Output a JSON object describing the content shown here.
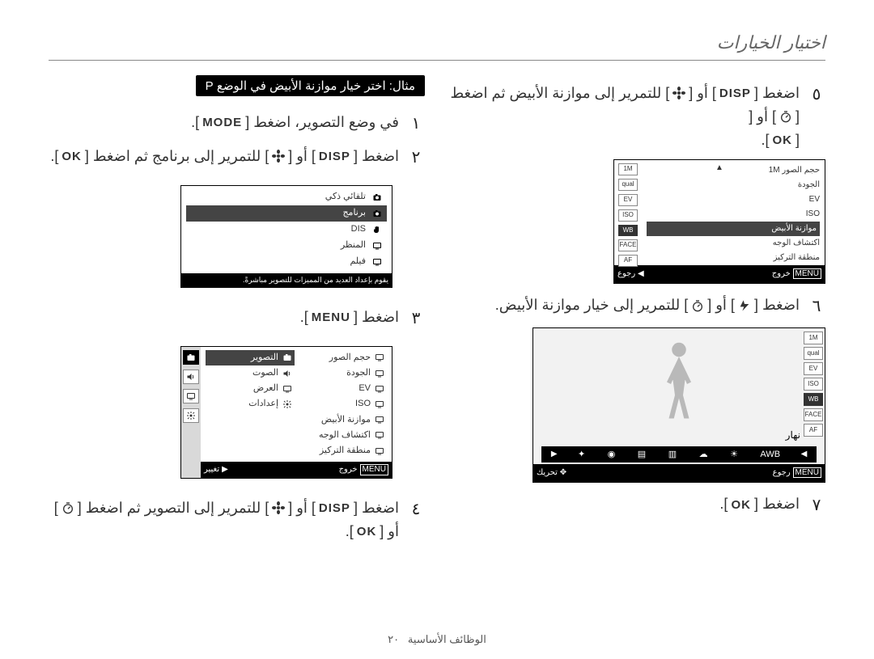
{
  "page": {
    "header": "اختيار الخيارات",
    "footer_label": "الوظائف الأساسية",
    "footer_page": "٢٠"
  },
  "example_badge": "مثال: اختر خيار موازنة الأبيض في الوضع P",
  "steps": {
    "n1": "١",
    "n2": "٢",
    "n3": "٣",
    "n4": "٤",
    "n5": "٥",
    "n6": "٦",
    "n7": "٧",
    "s1_a": "في وضع التصوير، اضغط [",
    "s1_b": "].",
    "s2_a": "اضغط [",
    "s2_b": "] أو [",
    "s2_c": "] للتمرير إلى برنامج ثم اضغط [",
    "s2_d": "].",
    "s3_a": "اضغط [",
    "s3_b": "].",
    "s4_a": "اضغط [",
    "s4_b": "] أو [",
    "s4_c": "] للتمرير إلى التصوير ثم اضغط [",
    "s4_d": "] أو [",
    "s4_e": "].",
    "s5_a": "اضغط [",
    "s5_b": "] أو [",
    "s5_c": "] للتمرير إلى موازنة الأبيض ثم اضغط [",
    "s5_d": "] أو [",
    "s5_e": "].",
    "s6_a": "اضغط [",
    "s6_b": "] أو [",
    "s6_c": "] للتمرير إلى خيار موازنة الأبيض.",
    "s7_a": "اضغط [",
    "s7_b": "]."
  },
  "keys": {
    "mode": "MODE",
    "disp": "DISP",
    "menu": "MENU",
    "ok": "OK",
    "macro": "flower-icon",
    "timer": "timer-icon",
    "flash": "flash-icon"
  },
  "screen_mode": {
    "items": [
      {
        "icon": "camera-auto-icon",
        "label": "تلقائي ذكي"
      },
      {
        "icon": "camera-icon",
        "label": "برنامج",
        "selected": true
      },
      {
        "icon": "hand-icon",
        "label": "DIS"
      },
      {
        "icon": "landscape-icon",
        "label": "المنظر"
      },
      {
        "icon": "film-icon",
        "label": "فيلم"
      }
    ],
    "note": "يقوم بإعداد العديد من المميزات للتصوير مباشرةً."
  },
  "screen_menu": {
    "categories": [
      "camera-icon",
      "sound-icon",
      "display-icon",
      "settings-icon"
    ],
    "left_col": [
      {
        "icon": "size-icon",
        "label": "حجم الصور"
      },
      {
        "icon": "quality-icon",
        "label": "الجودة"
      },
      {
        "icon": "ev-icon",
        "label": "EV"
      },
      {
        "icon": "iso-icon",
        "label": "ISO"
      },
      {
        "icon": "wb-icon",
        "label": "موازنة الأبيض"
      },
      {
        "icon": "face-icon",
        "label": "اكتشاف الوجه"
      },
      {
        "icon": "af-area-icon",
        "label": "منطقة التركيز"
      }
    ],
    "right_col": [
      {
        "icon": "camera-icon",
        "label": "التصوير",
        "selected": true
      },
      {
        "icon": "sound-icon",
        "label": "الصوت"
      },
      {
        "icon": "display-icon",
        "label": "العرض"
      },
      {
        "icon": "settings-icon",
        "label": "إعدادات"
      }
    ],
    "footer_right": "خروج",
    "footer_right_btn": "MENU",
    "footer_left": "تغيير",
    "footer_left_icon": "▶"
  },
  "screen_shoot": {
    "left_icons": [
      "1M",
      "qual",
      "EV",
      "ISO",
      "WB",
      "FACE",
      "AF"
    ],
    "selected_index": 4,
    "labels": {
      "size": "حجم الصور",
      "quality": "الجودة",
      "ev": "EV",
      "iso": "ISO",
      "wb": "موازنة الأبيض",
      "face": "اكتشاف الوجه",
      "focus": "منطقة التركيز"
    },
    "right_label_1m": "1M",
    "footer_right": "خروج",
    "footer_right_btn": "MENU",
    "footer_left": "رجوع",
    "footer_left_icon": "◀"
  },
  "screen_wb": {
    "left_icons": [
      "1M",
      "qual",
      "EV",
      "ISO",
      "WB",
      "FACE",
      "AF"
    ],
    "selected_index": 4,
    "title": "نهار",
    "options": [
      "AWB",
      "daylight",
      "cloudy",
      "fluorescent-h",
      "fluorescent-l",
      "tungsten",
      "custom"
    ],
    "footer_right": "رجوع",
    "footer_right_btn": "MENU",
    "footer_left": "تحريك",
    "footer_left_icon": "✥"
  }
}
